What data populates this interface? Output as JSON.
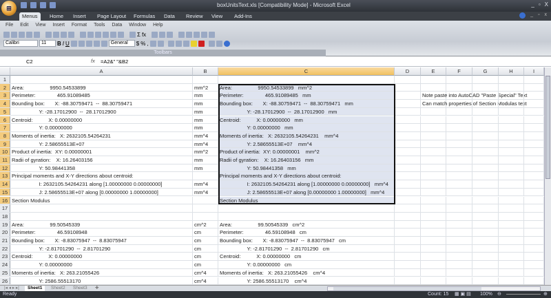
{
  "window": {
    "title": "boxUnitsText.xls  [Compatibility Mode] - Microsoft Excel",
    "controls": [
      "_",
      "▫",
      "X"
    ]
  },
  "ribbon_tabs": [
    "Menus",
    "Home",
    "Insert",
    "Page Layout",
    "Formulas",
    "Data",
    "Review",
    "View",
    "Add-Ins"
  ],
  "menus": [
    "File",
    "Edit",
    "View",
    "Insert",
    "Format",
    "Tools",
    "Data",
    "Window",
    "Help"
  ],
  "toolbar": {
    "font": "Calibri",
    "size": "11",
    "number_format": "General",
    "group_label": "Toolbars",
    "bold": "B",
    "italic": "I",
    "underline": "U",
    "currency": "$",
    "percent": "%",
    "comma": ","
  },
  "formula_bar": {
    "name_box": "C2",
    "fx": "fx",
    "formula": "=A2&\"  \"&B2"
  },
  "columns": [
    "A",
    "B",
    "C",
    "D",
    "E",
    "F",
    "G",
    "H",
    "I"
  ],
  "rows": [
    {
      "n": "1",
      "a": "",
      "b": "",
      "c": "",
      "e": ""
    },
    {
      "n": "2",
      "a": "Area:                  9950.54533899",
      "b": "mm^2",
      "c": "Area:                  9950.54533899   mm^2",
      "e": ""
    },
    {
      "n": "3",
      "a": "Perimeter:               465.91089485",
      "b": "mm",
      "c": "Perimeter:               465.91089485   mm",
      "e": "Note paste into AutoCAD \"Paste Special\" Text"
    },
    {
      "n": "4",
      "a": "Bounding box:       X: -88.30759471  --  88.30759471",
      "b": "mm",
      "c": "Bounding box:       X: -88.30759471  --  88.30759471   mm",
      "e": "Can match properties of Section Modulas text"
    },
    {
      "n": "5",
      "a": "                   Y: -28.17012900  --  28.17012900",
      "b": "mm",
      "c": "                   Y: -28.17012900  --  28.17012900   mm",
      "e": ""
    },
    {
      "n": "6",
      "a": "Centroid:           X: 0.00000000",
      "b": "mm",
      "c": "Centroid:           X: 0.00000000   mm",
      "e": ""
    },
    {
      "n": "7",
      "a": "                   Y: 0.00000000",
      "b": "mm",
      "c": "                   Y: 0.00000000   mm",
      "e": ""
    },
    {
      "n": "8",
      "a": "Moments of inertia:   X: 2632105.54264231",
      "b": "mm^4",
      "c": "Moments of inertia:   X: 2632105.54264231    mm^4",
      "e": ""
    },
    {
      "n": "9",
      "a": "                   Y: 2.58655513E+07",
      "b": "mm^4",
      "c": "                   Y: 2.58655513E+07    mm^4",
      "e": ""
    },
    {
      "n": "10",
      "a": "Product of inertia:  XY: 0.00000001",
      "b": "mm^2",
      "c": "Product of inertia:  XY: 0.00000001    mm^2",
      "e": ""
    },
    {
      "n": "11",
      "a": "Radii of gyration:    X: 16.26403156",
      "b": "mm",
      "c": "Radii of gyration:    X: 16.26403156   mm",
      "e": ""
    },
    {
      "n": "12",
      "a": "                   Y: 50.98441358",
      "b": "mm",
      "c": "                   Y: 50.98441358   mm",
      "e": ""
    },
    {
      "n": "13",
      "a": "Principal moments and X-Y directions about centroid:",
      "b": "",
      "c": "Principal moments and X-Y directions about centroid:",
      "e": ""
    },
    {
      "n": "14",
      "a": "                   I: 2632105.54264231 along [1.00000000 0.00000000]",
      "b": "mm^4",
      "c": "                   I: 2632105.54264231 along [1.00000000 0.00000000]   mm^4",
      "e": ""
    },
    {
      "n": "15",
      "a": "                   J: 2.58655513E+07 along [0.00000000 1.00000000]",
      "b": "mm^4",
      "c": "                   J: 2.58655513E+07 along [0.00000000 1.00000000]   mm^4",
      "e": ""
    },
    {
      "n": "16",
      "a": "Section Modulus",
      "b": "",
      "c": "Section Modulus",
      "e": ""
    },
    {
      "n": "17",
      "a": "",
      "b": "",
      "c": "",
      "e": ""
    },
    {
      "n": "18",
      "a": "",
      "b": "",
      "c": "",
      "e": ""
    },
    {
      "n": "19",
      "a": "Area:                  99.50545339",
      "b": "cm^2",
      "c": "Area:                  99.50545339   cm^2",
      "e": ""
    },
    {
      "n": "20",
      "a": "Perimeter:               46.59108948",
      "b": "cm",
      "c": "Perimeter:               46.59108948   cm",
      "e": ""
    },
    {
      "n": "21",
      "a": "Bounding box:       X: -8.83075947  --  8.83075947",
      "b": "cm",
      "c": "Bounding box:       X: -8.83075947  --  8.83075947   cm",
      "e": ""
    },
    {
      "n": "22",
      "a": "                   Y: -2.81701290  --  2.81701290",
      "b": "cm",
      "c": "                   Y: -2.81701290  --  2.81701290   cm",
      "e": ""
    },
    {
      "n": "23",
      "a": "Centroid:           X: 0.00000000",
      "b": "cm",
      "c": "Centroid:           X: 0.00000000   cm",
      "e": ""
    },
    {
      "n": "24",
      "a": "                   Y: 0.00000000",
      "b": "cm",
      "c": "                   Y: 0.00000000   cm",
      "e": ""
    },
    {
      "n": "25",
      "a": "Moments of inertia:   X: 263.21055426",
      "b": "cm^4",
      "c": "Moments of inertia:   X: 263.21055426    cm^4",
      "e": ""
    },
    {
      "n": "26",
      "a": "                   Y: 2586.55513170",
      "b": "cm^4",
      "c": "                   Y: 2586.55513170    cm^4",
      "e": ""
    }
  ],
  "sheets": [
    "Sheet1",
    "Sheet2",
    "Sheet3"
  ],
  "status": {
    "ready": "Ready",
    "count": "Count: 15",
    "zoom": "100%"
  }
}
